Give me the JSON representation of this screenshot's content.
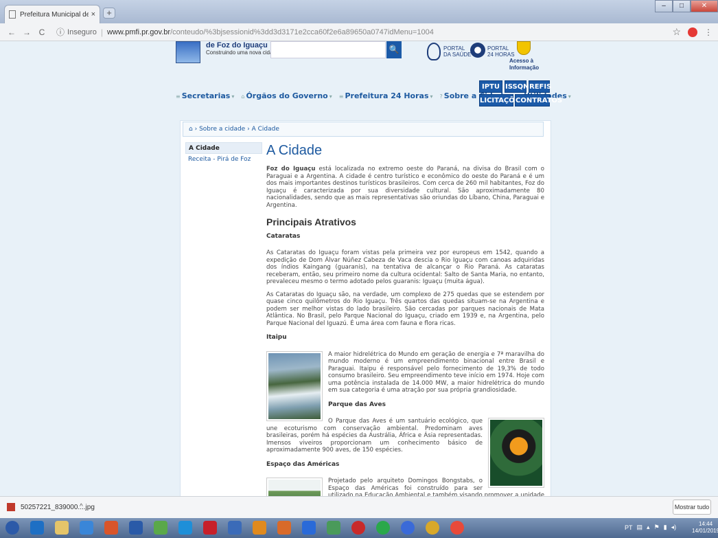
{
  "browser": {
    "tab_title": "Prefeitura Municipal de Foz do I...",
    "tab_close": "×",
    "new_tab": "+",
    "window_controls": [
      "–",
      "□",
      "✕"
    ],
    "back": "←",
    "forward": "→",
    "reload": "C",
    "insecure_label": "Inseguro",
    "url_host": "www.pmfi.pr.gov.br",
    "url_path": "/conteudo/%3bjsessionid%3dd3d3171e2cca60f2e6a89650a0747idMenu=1004",
    "star": "☆",
    "menu": "⋮"
  },
  "header": {
    "logo_title": "de Foz do Iguaçu",
    "logo_subtitle": "Construindo uma nova cidade",
    "search_placeholder": "",
    "search_button": "🔍",
    "portal_saude_1": "PORTAL",
    "portal_saude_2": "DA SAÚDE",
    "portal_24_1": "PORTAL",
    "portal_24_2": "24 HORAS",
    "acesso_1": "Acesso à",
    "acesso_2": "Informação"
  },
  "nav": {
    "items": [
      "Secretarias",
      "Órgãos do Governo",
      "Prefeitura 24 Horas",
      "Sobre a Cidade",
      "Utilidades"
    ],
    "buttons": [
      "IPTU",
      "ISSQN",
      "REFIS",
      "LICITAÇÕES",
      "CONTRATOS"
    ]
  },
  "breadcrumb": {
    "home": "⌂",
    "sep": "›",
    "item1": "Sobre a cidade",
    "item2": "A Cidade"
  },
  "sidebar": {
    "items": [
      "A Cidade",
      "Receita - Pirá de Foz"
    ]
  },
  "article": {
    "title": "A Cidade",
    "intro_bold": "Foz do Iguaçu",
    "intro": " está localizada no extremo oeste do Paraná, na divisa do Brasil com o Paraguai e a Argentina. A cidade é centro turístico e econômico do oeste do Paraná e é um dos mais importantes destinos turísticos brasileiros. Com cerca de 260 mil habitantes, Foz do Iguaçu é caracterizada por sua diversidade cultural. São aproximadamente 80 nacionalidades, sendo que as mais representativas são oriundas do Líbano, China, Paraguai e Argentina.",
    "section_title": "Principais Atrativos",
    "cataratas_title": "Cataratas",
    "cataratas_p1": "As Cataratas do Iguaçu foram vistas pela primeira vez por europeus em 1542, quando a expedição de Dom Álvar Núñez Cabeza de Vaca descia o Rio Iguaçu com canoas adquiridas dos índios Kaingang (guaranis), na tentativa de alcançar o Rio Paraná. As cataratas receberam, então, seu primeiro nome da cultura ocidental: Salto de Santa Maria, no entanto, prevaleceu mesmo o termo adotado pelos guaranis: Iguaçu (muita água).",
    "cataratas_p2": "As Cataratas do Iguaçu são, na verdade, um complexo de 275 quedas que se estendem por quase cinco quilômetros do Rio Iguaçu. Três quartos das quedas situam-se na Argentina e podem ser melhor vistas do lado brasileiro. São cercadas por parques nacionais de Mata Atlântica. No Brasil, pelo Parque Nacional do Iguaçu, criado em 1939 e, na Argentina, pelo Parque Nacional del Iguazú. É uma área com fauna e flora ricas.",
    "itaipu_title": "Itaipu",
    "itaipu_p": "A maior hidrelétrica do Mundo em geração de energia e 7ª maravilha do mundo moderno é um empreendimento binacional entre Brasil e Paraguai. Itaipu é responsável pelo fornecimento de 19,3% de todo consumo brasileiro. Seu empreendimento teve início em 1974. Hoje com uma potência instalada de 14.000 MW, a maior hidrelétrica do mundo em sua categoria é uma atração por sua própria grandiosidade.",
    "aves_title": "Parque das Aves",
    "aves_p": "O Parque das Aves é um santuário ecológico, que une ecoturismo com conservação ambiental. Predominam aves brasileiras, porém há espécies da Austrália, África e Ásia representadas. Imensos viveiros proporcionam um conhecimento básico de aproximadamente 900 aves, de 150 espécies.",
    "americas_title": "Espaço das Américas",
    "americas_p": "Projetado pelo arquiteto Domingos Bongstabs, o Espaço das Américas foi construído para ser utilizado na Educação Ambiental e também visando promover a unidade cultural das Américas portuguesa e espanhola."
  },
  "download": {
    "filename": "50257221_839000....jpg",
    "caret": "^",
    "show_all": "Mostrar tudo"
  },
  "taskbar": {
    "lang": "PT",
    "time": "14:44",
    "date": "14/01/2019"
  },
  "colors": {
    "accent": "#1b5aa8",
    "link": "#1e5aa0",
    "page_bg": "#e8f1f8"
  }
}
